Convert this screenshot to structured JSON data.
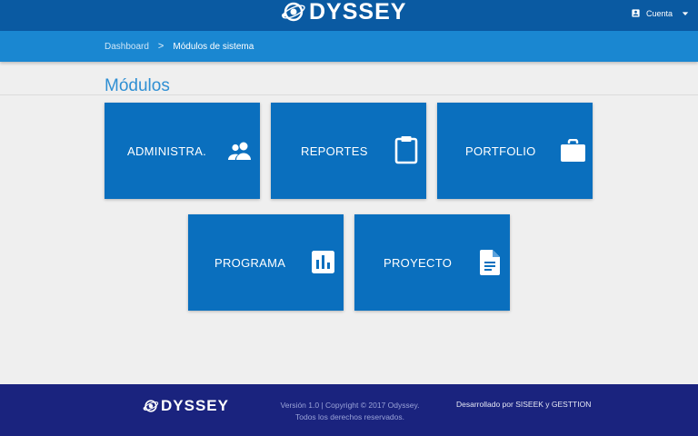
{
  "header": {
    "logo_text": "DYSSEY",
    "account_label": "Cuenta"
  },
  "breadcrumb": {
    "link": "Dashboard",
    "separator": ">",
    "current": "Módulos de sistema"
  },
  "page": {
    "title": "Módulos"
  },
  "modules": [
    {
      "label": "ADMINISTRA.",
      "icon": "group-icon"
    },
    {
      "label": "REPORTES",
      "icon": "clipboard-icon"
    },
    {
      "label": "PORTFOLIO",
      "icon": "briefcase-icon"
    },
    {
      "label": "PROGRAMA",
      "icon": "bar-chart-icon"
    },
    {
      "label": "PROYECTO",
      "icon": "document-icon"
    }
  ],
  "footer": {
    "logo_text": "DYSSEY",
    "copyright": "Versión 1.0 | Copyright © 2017 Odyssey. Todos los derechos reservados.",
    "developed_by": "Desarrollado por SISEEK y GESTTION"
  },
  "colors": {
    "header_bg": "#0a5aa2",
    "breadcrumb_bg": "#1a87d1",
    "tile_bg": "#0a6fbe",
    "footer_bg": "#1a237e",
    "title_color": "#2f8fd3"
  }
}
